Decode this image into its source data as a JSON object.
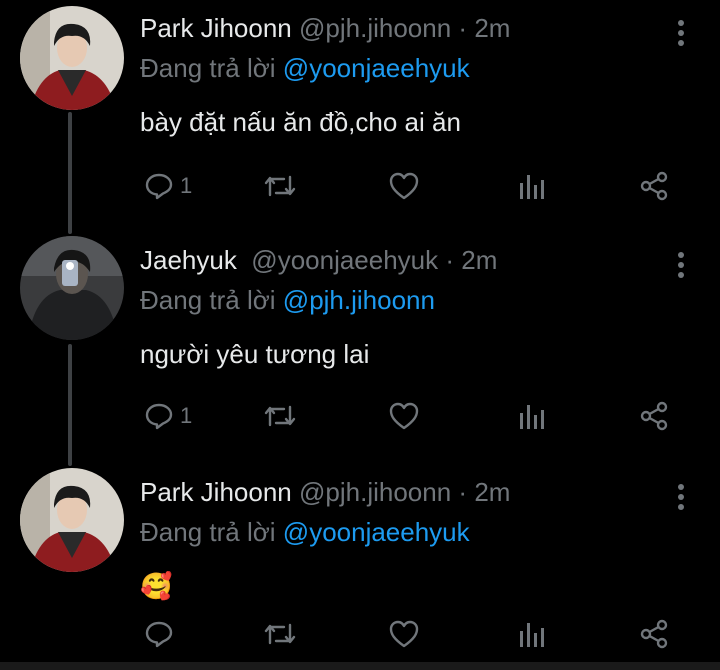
{
  "theme": {
    "background": "#000000",
    "text": "#E7E9EA",
    "muted": "#71767B",
    "accent": "#1D9BF0"
  },
  "tweets": [
    {
      "name": "Park Jihoonn",
      "handle": "@pjh.jihoonn",
      "separator": "·",
      "time": "2m",
      "reply_prefix": "Đang trả lời",
      "reply_to": "@yoonjaeehyuk",
      "text": "bày đặt nấu ăn đồ,cho ai ăn",
      "reply_count": "1",
      "avatar": "avatar-park-jihoonn"
    },
    {
      "name": "Jaehyuk",
      "handle": "@yoonjaeehyuk",
      "separator": "·",
      "time": "2m",
      "reply_prefix": "Đang trả lời",
      "reply_to": "@pjh.jihoonn",
      "text": "người yêu tương lai",
      "reply_count": "1",
      "avatar": "avatar-jaehyuk"
    },
    {
      "name": "Park Jihoonn",
      "handle": "@pjh.jihoonn",
      "separator": "·",
      "time": "2m",
      "reply_prefix": "Đang trả lời",
      "reply_to": "@yoonjaeehyuk",
      "text": "🥰",
      "reply_count": "",
      "avatar": "avatar-park-jihoonn"
    }
  ],
  "icons": [
    "reply-icon",
    "retweet-icon",
    "like-icon",
    "analytics-icon",
    "share-icon",
    "more-icon"
  ]
}
